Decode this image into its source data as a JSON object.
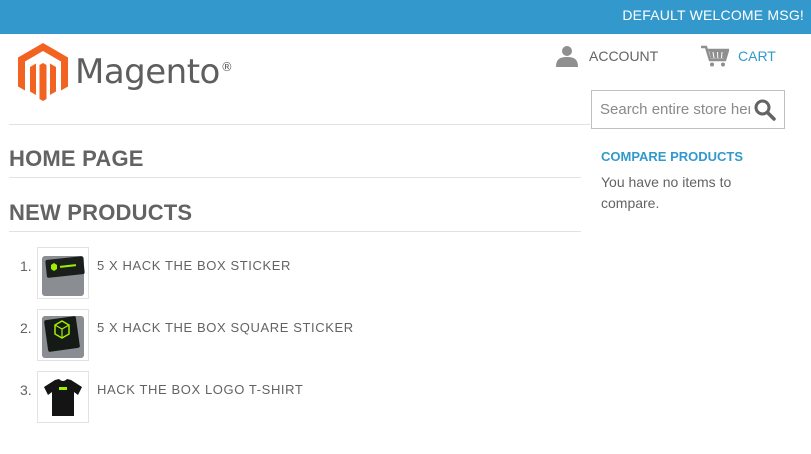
{
  "header": {
    "welcome": "DEFAULT WELCOME MSG!",
    "brand": "Magento",
    "brand_mark": "®",
    "account_label": "ACCOUNT",
    "cart_label": "CART"
  },
  "search": {
    "placeholder": "Search entire store here...",
    "button_icon": "search-icon"
  },
  "main": {
    "page_title": "HOME PAGE",
    "section_title": "NEW PRODUCTS",
    "products": [
      {
        "index": "1.",
        "name": "5 X HACK THE BOX STICKER",
        "thumb": "sticker"
      },
      {
        "index": "2.",
        "name": "5 X HACK THE BOX SQUARE STICKER",
        "thumb": "square-sticker"
      },
      {
        "index": "3.",
        "name": "HACK THE BOX LOGO T-SHIRT",
        "thumb": "t-shirt"
      }
    ]
  },
  "compare": {
    "title": "COMPARE PRODUCTS",
    "empty_text": "You have no items to compare."
  },
  "colors": {
    "accent": "#3399cc",
    "text": "#636363",
    "logo_orange": "#f26322"
  }
}
